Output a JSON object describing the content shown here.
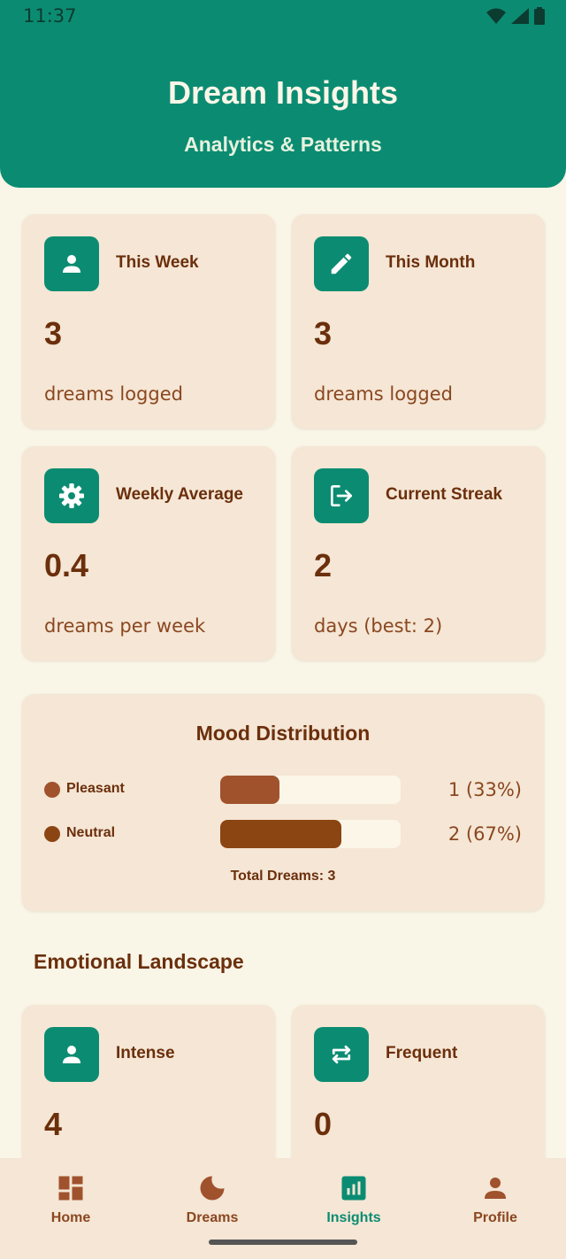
{
  "status_bar": {
    "time": "11:37"
  },
  "header": {
    "title": "Dream Insights",
    "subtitle": "Analytics & Patterns"
  },
  "stats": [
    {
      "label": "This Week",
      "value": "3",
      "desc": "dreams logged",
      "icon": "person-icon"
    },
    {
      "label": "This Month",
      "value": "3",
      "desc": "dreams logged",
      "icon": "pencil-icon"
    },
    {
      "label": "Weekly Average",
      "value": "0.4",
      "desc": "dreams per week",
      "icon": "gear-icon"
    },
    {
      "label": "Current Streak",
      "value": "2",
      "desc": "days (best: 2)",
      "icon": "exit-icon"
    }
  ],
  "mood": {
    "title": "Mood Distribution",
    "rows": [
      {
        "name": "Pleasant",
        "count": "1 (33%)",
        "fraction": 0.33,
        "color": "#a0522d"
      },
      {
        "name": "Neutral",
        "count": "2 (67%)",
        "fraction": 0.67,
        "color": "#8b4513"
      }
    ],
    "total": "Total Dreams: 3"
  },
  "emotional": {
    "title": "Emotional Landscape",
    "cards": [
      {
        "label": "Intense",
        "value": "4",
        "icon": "person-icon"
      },
      {
        "label": "Frequent",
        "value": "0",
        "icon": "repeat-icon"
      }
    ]
  },
  "nav": {
    "items": [
      {
        "label": "Home",
        "icon": "dashboard-icon",
        "active": false
      },
      {
        "label": "Dreams",
        "icon": "moon-icon",
        "active": false
      },
      {
        "label": "Insights",
        "icon": "insights-icon",
        "active": true
      },
      {
        "label": "Profile",
        "icon": "profile-icon",
        "active": false
      }
    ]
  },
  "colors": {
    "primary": "#0b8c72",
    "card": "#f5e6d5",
    "background": "#f9f5e7",
    "text": "#6b2f0c"
  }
}
